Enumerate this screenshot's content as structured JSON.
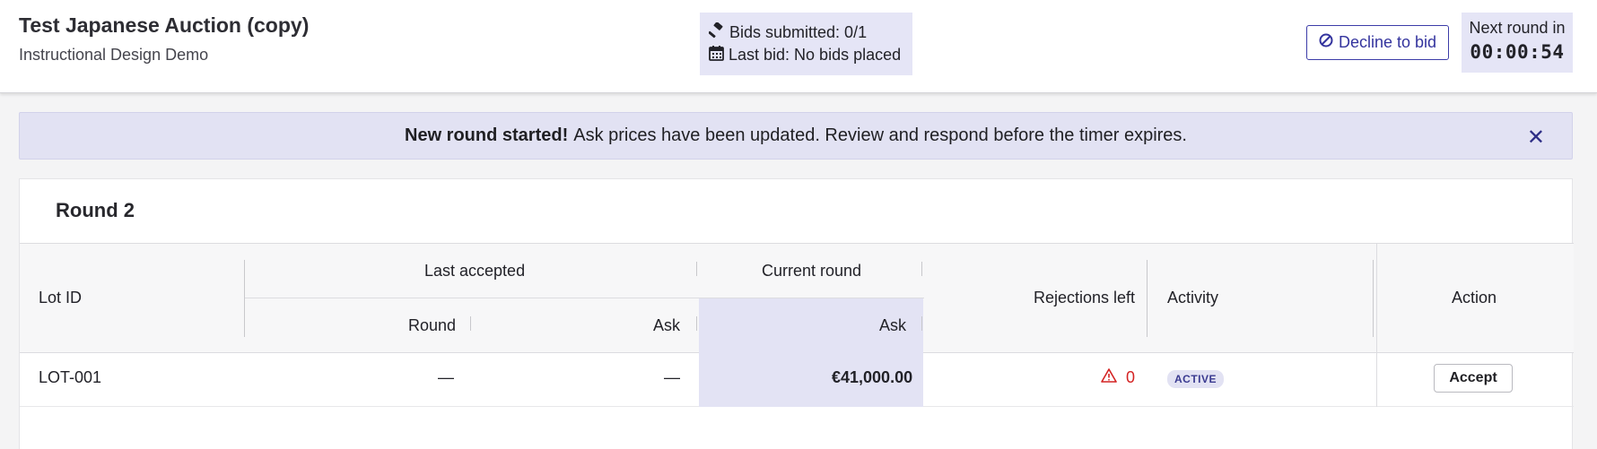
{
  "header": {
    "title": "Test Japanese Auction (copy)",
    "subtitle": "Instructional Design Demo",
    "bids_submitted": "Bids submitted: 0/1",
    "last_bid": "Last bid: No bids placed",
    "decline_label": "Decline to bid",
    "next_round_label": "Next round in",
    "timer": "00:00:54"
  },
  "banner": {
    "bold": "New round started!",
    "text": "Ask prices have been updated. Review and respond before the timer expires.",
    "close": "✕"
  },
  "round": {
    "title": "Round 2",
    "columns": {
      "lot_id": "Lot ID",
      "last_accepted": "Last accepted",
      "current_round": "Current round",
      "round": "Round",
      "ask": "Ask",
      "current_ask": "Ask",
      "rejections_left": "Rejections left",
      "activity": "Activity",
      "action": "Action"
    },
    "rows": [
      {
        "lot_id": "LOT-001",
        "last_round": "—",
        "last_ask": "—",
        "current_ask": "€41,000.00",
        "rejections_left": "0",
        "activity": "ACTIVE",
        "action": "Accept"
      }
    ]
  },
  "colors": {
    "accent": "#34349e",
    "highlight": "#e3e3f4",
    "warning": "#d42323"
  }
}
